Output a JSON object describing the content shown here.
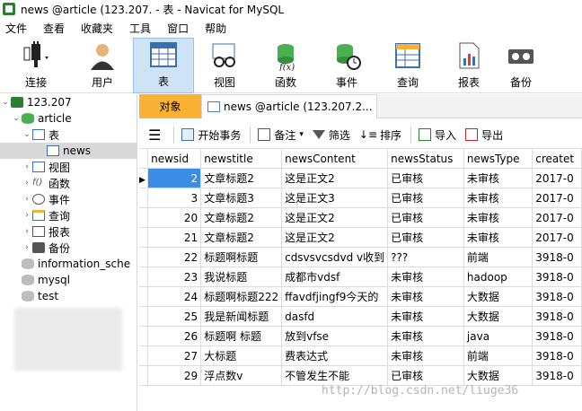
{
  "window": {
    "title": "news @article (123.207.   - 表 - Navicat for MySQL"
  },
  "menu": [
    "文件",
    "查看",
    "收藏夹",
    "工具",
    "窗口",
    "帮助"
  ],
  "toolbar": [
    {
      "label": "连接",
      "icon": "plug-icon"
    },
    {
      "label": "用户",
      "icon": "user-icon"
    },
    {
      "label": "表",
      "icon": "table-icon"
    },
    {
      "label": "视图",
      "icon": "view-glasses-icon"
    },
    {
      "label": "函数",
      "icon": "function-icon"
    },
    {
      "label": "事件",
      "icon": "event-clock-icon"
    },
    {
      "label": "查询",
      "icon": "query-icon"
    },
    {
      "label": "报表",
      "icon": "report-icon"
    },
    {
      "label": "备份",
      "icon": "backup-icon"
    }
  ],
  "sidebar": {
    "connection": "123.207",
    "database": "article",
    "tables_group": "表",
    "table_news": "news",
    "groups": [
      "视图",
      "函数",
      "事件",
      "查询",
      "报表",
      "备份"
    ],
    "other_dbs": [
      "information_sche",
      "mysql",
      "test"
    ]
  },
  "tabs": {
    "objects": "对象",
    "news": "news @article (123.207.2..."
  },
  "subtoolbar": {
    "begin_tx": "开始事务",
    "note": "备注",
    "filter": "筛选",
    "sort": "排序",
    "import": "导入",
    "export": "导出"
  },
  "grid": {
    "columns": [
      "newsid",
      "newstitle",
      "newsContent",
      "newsStatus",
      "newsType",
      "createt"
    ],
    "rows": [
      [
        "2",
        "文章标题2",
        "这是正文2",
        "已审核",
        "未审核",
        "2017-0"
      ],
      [
        "3",
        "文章标题3",
        "这是正文3",
        "已审核",
        "未审核",
        "2017-0"
      ],
      [
        "20",
        "文章标题2",
        "这是正文2",
        "已审核",
        "未审核",
        "2017-0"
      ],
      [
        "21",
        "文章标题2",
        "这是正文2",
        "已审核",
        "未审核",
        "2017-0"
      ],
      [
        "22",
        "标题啊标题",
        "cdsvsvcsdvd v收到",
        "???",
        "前端",
        "3918-0"
      ],
      [
        "23",
        "我说标题",
        "成都市vdsf",
        "未审核",
        "hadoop",
        "3918-0"
      ],
      [
        "24",
        "标题啊标题222",
        "ffavdfjingf9今天的",
        "未审核",
        "大数据",
        "3918-0"
      ],
      [
        "25",
        "我是新闻标题",
        "dasfd",
        "未审核",
        "大数据",
        "3918-0"
      ],
      [
        "26",
        "标题啊 标题",
        "放到vfse",
        "未审核",
        "java",
        "3918-0"
      ],
      [
        "27",
        "大标题",
        "费表达式",
        "未审核",
        "前端",
        "3918-0"
      ],
      [
        "29",
        "浮点数v",
        "不管发生不能",
        "已审核",
        "大数据",
        "3918-0"
      ]
    ]
  },
  "watermark": "http://blog.csdn.net/liuge36",
  "colors": {
    "objects_tab": "#f9b233",
    "selected_tool": "#cfe3f7",
    "selected_cell": "#3a8ee6"
  }
}
